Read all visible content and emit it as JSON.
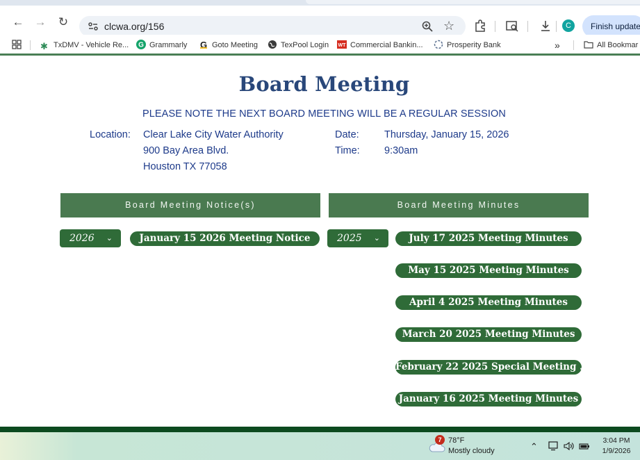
{
  "browser": {
    "url": "clcwa.org/156",
    "update_label": "Finish update",
    "profile_initial": "C",
    "bookmarks": [
      {
        "label": "TxDMV - Vehicle Re...",
        "icon": "txdmv-star-icon"
      },
      {
        "label": "Grammarly",
        "icon": "grammarly-icon"
      },
      {
        "label": "Goto Meeting",
        "icon": "goto-icon"
      },
      {
        "label": "TexPool Login",
        "icon": "globe-icon"
      },
      {
        "label": "Commercial Bankin...",
        "icon": "bank-icon"
      },
      {
        "label": "Prosperity Bank",
        "icon": "loading-icon"
      }
    ],
    "overflow_label": "»",
    "all_bookmarks_label": "All Bookmar"
  },
  "page": {
    "title": "Board Meeting",
    "notice": "PLEASE NOTE THE NEXT BOARD MEETING WILL BE A REGULAR SESSION",
    "location_label": "Location:",
    "location_lines": [
      "Clear Lake City Water Authority",
      "900 Bay Area Blvd.",
      "Houston TX 77058"
    ],
    "date_label": "Date:",
    "date_value": "Thursday, January 15, 2026",
    "time_label": "Time:",
    "time_value": "9:30am"
  },
  "notices": {
    "heading": "Board Meeting Notice(s)",
    "year": "2026",
    "items": [
      "January 15 2026 Meeting Notice"
    ]
  },
  "minutes": {
    "heading": "Board Meeting Minutes",
    "year": "2025",
    "items": [
      "July 17 2025 Meeting Minutes",
      "May 15 2025 Meeting Minutes",
      "April 4 2025 Meeting Minutes",
      "March 20 2025 Meeting Minutes",
      "February 22 2025 Special Meeting ...",
      "January 16 2025 Meeting Minutes"
    ]
  },
  "taskbar": {
    "weather_badge": "7",
    "weather_temp": "78°F",
    "weather_desc": "Mostly cloudy",
    "time": "3:04 PM",
    "date": "1/9/2026"
  },
  "colors": {
    "header_green": "#4a7a50",
    "button_green": "#2f6b38",
    "title_blue": "#29477a",
    "text_blue": "#1d3a8a"
  }
}
